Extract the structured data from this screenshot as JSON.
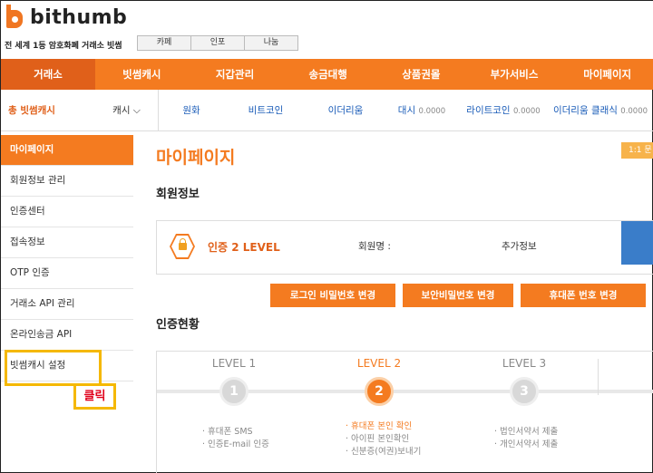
{
  "brand": {
    "name": "bithumb",
    "tagline": "전 세계 1등 암호화폐 거래소 빗썸"
  },
  "toplinks": [
    "카페",
    "인포",
    "나눔"
  ],
  "gnb": [
    "거래소",
    "빗썸캐시",
    "지갑관리",
    "송금대행",
    "상품권몰",
    "부가서비스",
    "마이페이지"
  ],
  "ticker": {
    "total": "총 빗썸캐시",
    "currency": "캐시",
    "coins": [
      {
        "name": "원화",
        "value": ""
      },
      {
        "name": "비트코인",
        "value": ""
      },
      {
        "name": "이더리움",
        "value": ""
      },
      {
        "name": "대시",
        "value": "0.0000"
      },
      {
        "name": "라이트코인",
        "value": "0.0000"
      },
      {
        "name": "이더리움 클래식",
        "value": "0.0000"
      }
    ]
  },
  "sidebar": [
    "마이페이지",
    "회원정보 관리",
    "인증센터",
    "접속정보",
    "OTP 인증",
    "거래소 API 관리",
    "온라인송금 API",
    "빗썸캐시 설정"
  ],
  "click_label": "클릭",
  "main": {
    "title": "마이페이지",
    "qna": "1:1 문",
    "member_section": "회원정보",
    "level_text": "인증 2 LEVEL",
    "member_name_label": "회원명 :",
    "extra_info": "추가정보",
    "buttons": [
      "로그인 비밀번호 변경",
      "보안비밀번호 변경",
      "휴대폰 번호 변경"
    ],
    "auth_section": "인증현황",
    "steps": [
      {
        "label": "LEVEL 1",
        "num": "1",
        "items": [
          "휴대폰 SMS",
          "인증E-mail 인증"
        ]
      },
      {
        "label": "LEVEL 2",
        "num": "2",
        "items": [
          "휴대폰 본인 확인",
          "아이핀 본인확인",
          "신분증(여권)보내기"
        ]
      },
      {
        "label": "LEVEL 3",
        "num": "3",
        "items": [
          "법인서약서 제출",
          "개인서약서 제출"
        ]
      }
    ]
  },
  "colors": {
    "accent": "#f47b20",
    "highlight": "#f5b800"
  }
}
